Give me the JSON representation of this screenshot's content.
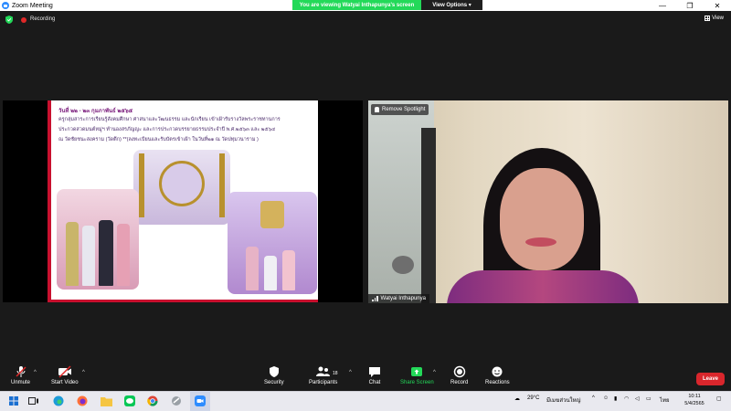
{
  "window": {
    "title": "Zoom Meeting",
    "controls": [
      "—",
      "❐",
      "✕"
    ]
  },
  "banner": {
    "message": "You are viewing Watyai Inthapunya's screen",
    "view_options": "View Options ▾"
  },
  "status": {
    "recording": "Recording",
    "view": "View"
  },
  "slide": {
    "date": "วันที่ ๒๒ - ๒๓ กุมภาพันธ์ ๒๕๖๕",
    "lines": [
      "ครูกลุ่มสาระการเรียนรู้สังคมศึกษา ศาสนาและวัฒนธรรม และนักเรียน เข้าเฝ้ารับรางวัลพระราชทานการ",
      "ประกวดสวดมนต์หมู่ฯ ทำนองสรภัญญะ และการประกวดบรรยายธรรมประจำปี พ.ศ.๒๕๖๓ และ ๒๕๖๔",
      "ณ วัดชัยชนะสงคราม (วัดตึก) **(ลงทะเบียนและรับบัตรเข้าเฝ้า ในวันที่๒๑ ณ วัดปทุมวนาราม )"
    ]
  },
  "video": {
    "remove_spotlight": "Remove Spotlight",
    "participant_name": "Watyai Inthapunya"
  },
  "toolbar": {
    "unmute": "Unmute",
    "start_video": "Start Video",
    "security": "Security",
    "participants": "Participants",
    "participants_count": "18",
    "chat": "Chat",
    "share_screen": "Share Screen",
    "record": "Record",
    "reactions": "Reactions",
    "leave": "Leave"
  },
  "taskbar": {
    "weather_temp": "29°C",
    "weather_desc": "มีเมฆส่วนใหญ่",
    "language": "ไทย",
    "time": "10:11",
    "date": "5/4/2565"
  },
  "colors": {
    "share_green": "#23d959",
    "leave_red": "#d9262c",
    "slide_border": "#c8102e"
  }
}
